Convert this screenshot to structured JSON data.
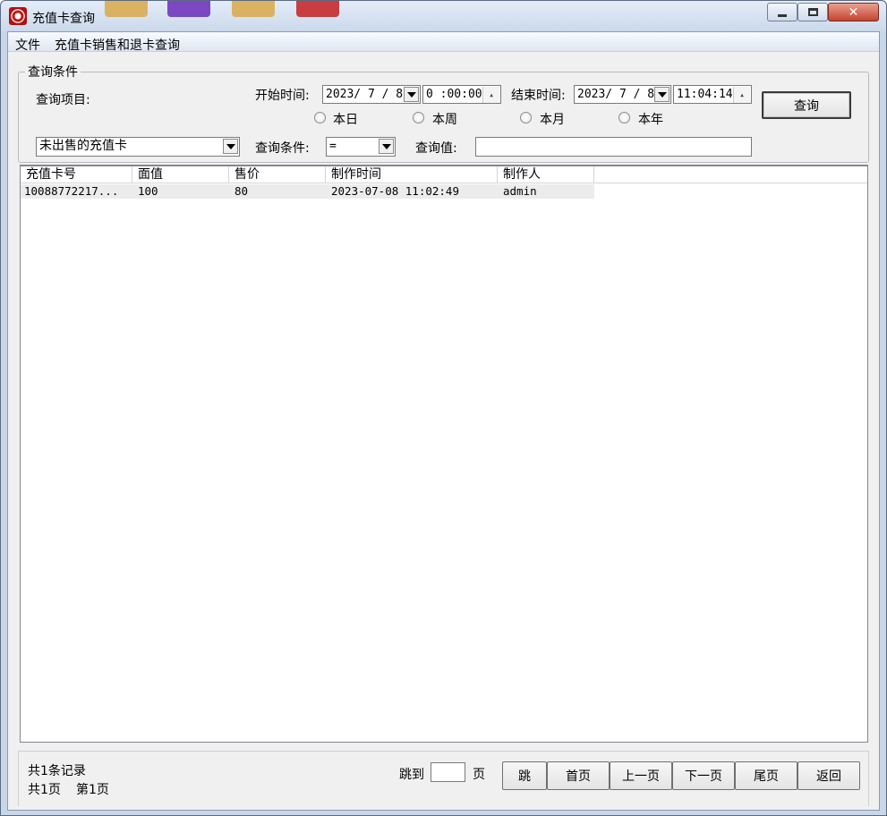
{
  "window": {
    "title": "充值卡查询",
    "controls": {
      "minimize": "minimize",
      "maximize": "maximize",
      "close": "✕"
    }
  },
  "menu": {
    "items": [
      "文件",
      "充值卡销售和退卡查询"
    ]
  },
  "query": {
    "group_title": "查询条件",
    "item_label": "查询项目:",
    "item_value": "未出售的充值卡",
    "start_label": "开始时间:",
    "start_date": "2023/ 7 / 8",
    "start_time": "0 :00:00",
    "end_label": "结束时间:",
    "end_date": "2023/ 7 / 8",
    "end_time": "11:04:14",
    "ranges": [
      "本日",
      "本周",
      "本月",
      "本年"
    ],
    "condition_label": "查询条件:",
    "condition_value": "=",
    "value_label": "查询值:",
    "value_text": "",
    "search_button": "查询"
  },
  "table": {
    "columns": [
      "充值卡号",
      "面值",
      "售价",
      "制作时间",
      "制作人"
    ],
    "rows": [
      [
        "10088772217...",
        "100",
        "80",
        "2023-07-08 11:02:49",
        "admin"
      ]
    ]
  },
  "footer": {
    "records": "共1条记录",
    "pages": "共1页",
    "current_page": "第1页",
    "jump_label": "跳到",
    "page_unit": "页",
    "jump_value": "",
    "buttons": [
      "跳",
      "首页",
      "上一页",
      "下一页",
      "尾页",
      "返回"
    ]
  },
  "colors": {
    "title_bg": "#cbd9ec",
    "close_button": "#c4442e",
    "row_highlight": "#ececec"
  }
}
